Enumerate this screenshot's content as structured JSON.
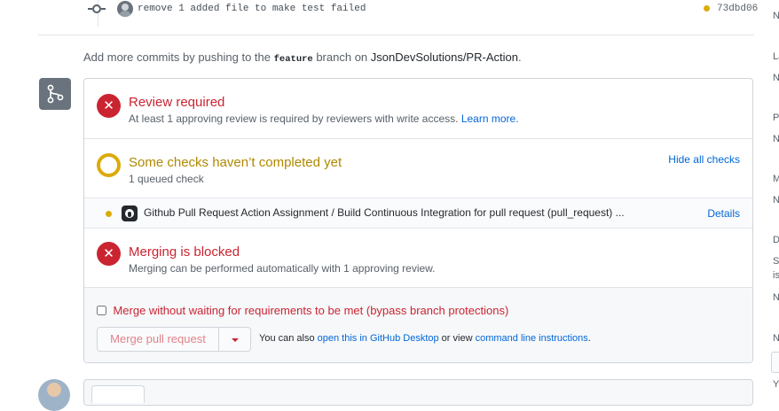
{
  "commit": {
    "message": "remove 1 added file to make test failed",
    "sha": "73dbd06"
  },
  "info": {
    "prefix": "Add more commits by pushing to the ",
    "branch": "feature",
    "middle": " branch on ",
    "repo": "JsonDevSolutions/PR-Action",
    "suffix": "."
  },
  "review": {
    "title": "Review required",
    "description": "At least 1 approving review is required by reviewers with write access. ",
    "learn_more": "Learn more."
  },
  "checks": {
    "title": "Some checks haven’t completed yet",
    "subtitle": "1 queued check",
    "hide_label": "Hide all checks",
    "items": [
      {
        "name": "Github Pull Request Action Assignment / Build Continuous Integration for pull request (pull_request) ...",
        "details_label": "Details",
        "status_color": "#dbab09"
      }
    ]
  },
  "blocked": {
    "title": "Merging is blocked",
    "description": "Merging can be performed automatically with 1 approving review."
  },
  "merge": {
    "bypass_label": "Merge without waiting for requirements to be met (bypass branch protections)",
    "button_label": "Merge pull request",
    "also_prefix": "You can also ",
    "desktop_link": "open this in GitHub Desktop",
    "or_view": " or view ",
    "cli_link": "command line instructions",
    "suffix": "."
  },
  "sidebar": {
    "fragments": [
      "N",
      "La",
      "N",
      "P",
      "N",
      "M",
      "N",
      "D",
      "S",
      "is",
      "N",
      "N",
      "Yo"
    ]
  },
  "colors": {
    "error": "#cb2431",
    "pending": "#dbab09",
    "link": "#0366d6"
  }
}
